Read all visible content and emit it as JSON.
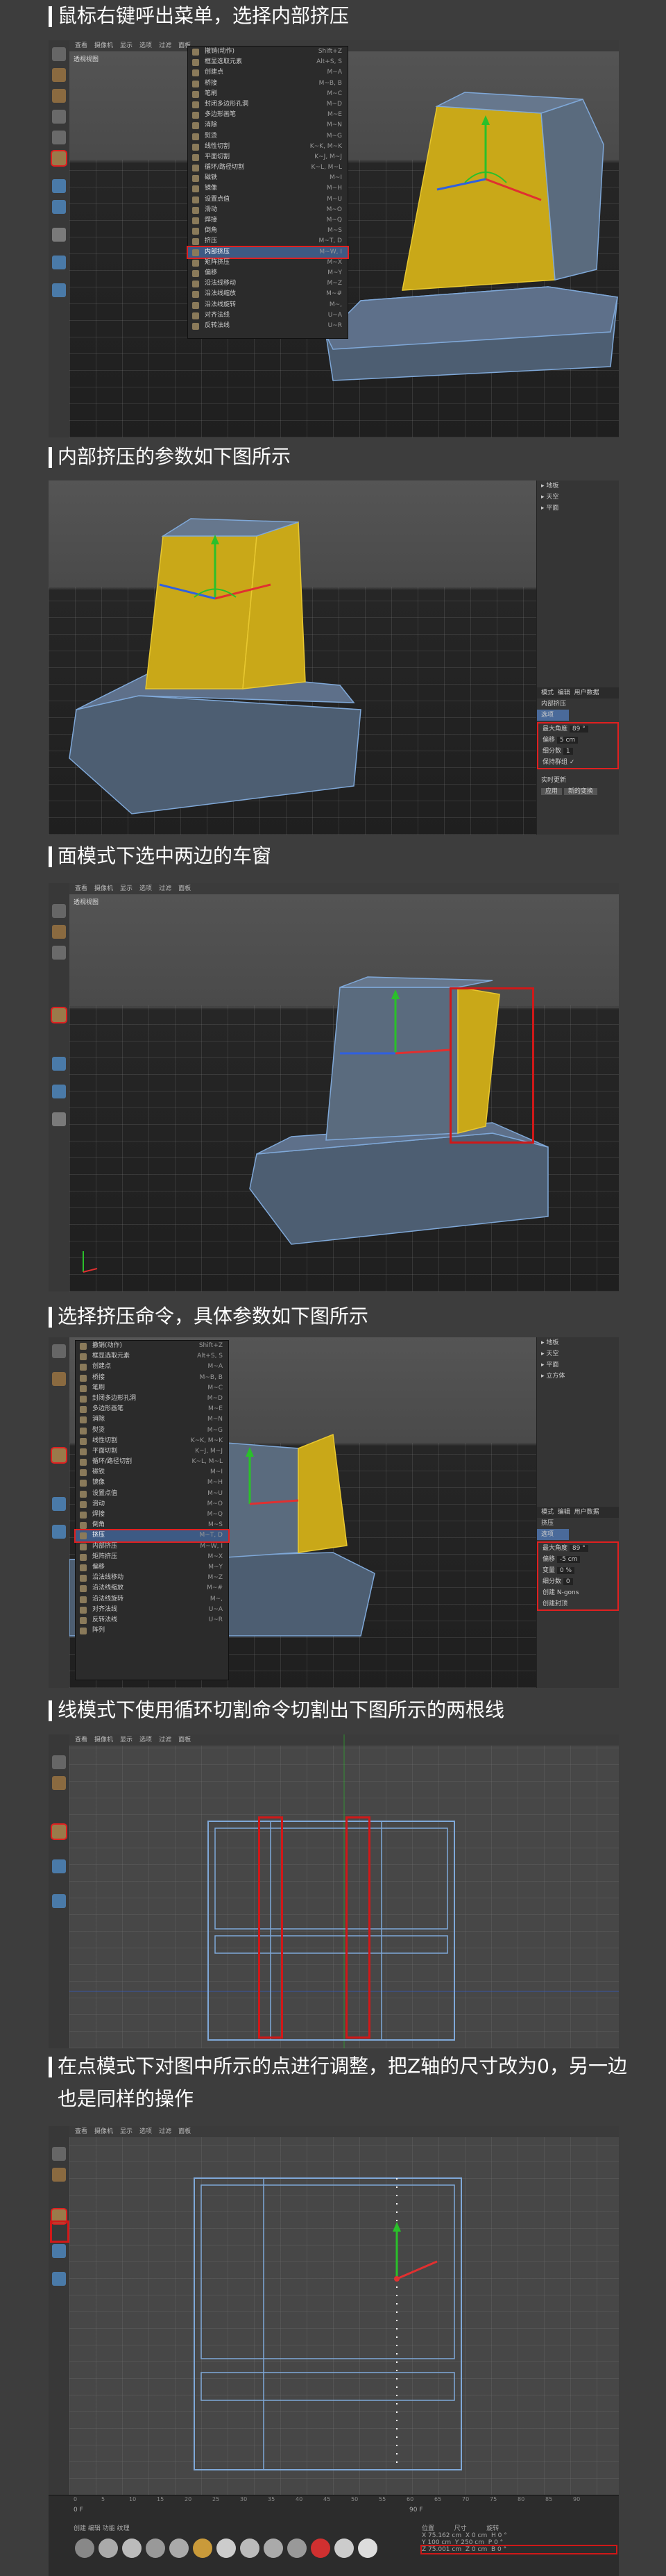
{
  "steps": [
    {
      "title": "鼠标右键呼出菜单，选择内部挤压"
    },
    {
      "title": "内部挤压的参数如下图所示"
    },
    {
      "title": "面模式下选中两边的车窗"
    },
    {
      "title": "选择挤压命令，具体参数如下图所示"
    },
    {
      "title": "线模式下使用循环切割命令切割出下图所示的两根线"
    },
    {
      "title": "在点模式下对图中所示的点进行调整，把Z轴的尺寸改为0，另一边",
      "title2": "也是同样的操作"
    }
  ],
  "viewport": {
    "menu": [
      "查看",
      "摄像机",
      "显示",
      "选项",
      "过滤",
      "面板"
    ],
    "label": "透视视图"
  },
  "context_menu_1": {
    "items": [
      {
        "label": "撤销(动作)",
        "shortcut": "Shift+Z"
      },
      {
        "label": "框显选取元素",
        "shortcut": "Alt+S, S"
      },
      {
        "label": "创建点",
        "shortcut": "M~A"
      },
      {
        "label": "桥接",
        "shortcut": "M~B, B"
      },
      {
        "label": "笔刷",
        "shortcut": "M~C"
      },
      {
        "label": "封闭多边形孔洞",
        "shortcut": "M~D"
      },
      {
        "label": "多边形画笔",
        "shortcut": "M~E"
      },
      {
        "label": "消除",
        "shortcut": "M~N"
      },
      {
        "label": "熨烫",
        "shortcut": "M~G"
      },
      {
        "label": "线性切割",
        "shortcut": "K~K, M~K"
      },
      {
        "label": "平面切割",
        "shortcut": "K~J, M~J"
      },
      {
        "label": "循环/路径切割",
        "shortcut": "K~L, M~L"
      },
      {
        "label": "磁铁",
        "shortcut": "M~I"
      },
      {
        "label": "镜像",
        "shortcut": "M~H"
      },
      {
        "label": "设置点值",
        "shortcut": "M~U"
      },
      {
        "label": "滑动",
        "shortcut": "M~O"
      },
      {
        "label": "焊接",
        "shortcut": "M~Q"
      },
      {
        "label": "倒角",
        "shortcut": "M~S"
      },
      {
        "label": "挤压",
        "shortcut": "M~T, D"
      },
      {
        "label": "内部挤压",
        "shortcut": "M~W, I"
      },
      {
        "label": "矩阵挤压",
        "shortcut": "M~X"
      },
      {
        "label": "偏移",
        "shortcut": "M~Y"
      },
      {
        "label": "沿法线移动",
        "shortcut": "M~Z"
      },
      {
        "label": "沿法线缩放",
        "shortcut": "M~#"
      },
      {
        "label": "沿法线旋转",
        "shortcut": "M~,"
      },
      {
        "label": "对齐法线",
        "shortcut": "U~A"
      },
      {
        "label": "反转法线",
        "shortcut": "U~R"
      }
    ]
  },
  "attributes_2": {
    "objects": [
      "地板",
      "天空",
      "平面",
      "立方体"
    ],
    "tabs": [
      "模式",
      "编辑",
      "用户数据"
    ],
    "tool_name": "内部挤压",
    "tab_options": "选项",
    "fields": [
      {
        "label": "最大角度",
        "value": "89 °"
      },
      {
        "label": "偏移",
        "value": "5 cm"
      },
      {
        "label": "细分数",
        "value": "1"
      },
      {
        "label": "保持群组",
        "value": "✓"
      }
    ],
    "buttons": [
      "应用",
      "新的变换"
    ],
    "realtime": "实时更新"
  },
  "context_menu_4": {
    "items": [
      {
        "label": "撤销(动作)",
        "shortcut": "Shift+Z"
      },
      {
        "label": "框显选取元素",
        "shortcut": "Alt+S, S"
      },
      {
        "label": "创建点",
        "shortcut": "M~A"
      },
      {
        "label": "桥接",
        "shortcut": "M~B, B"
      },
      {
        "label": "笔刷",
        "shortcut": "M~C"
      },
      {
        "label": "封闭多边形孔洞",
        "shortcut": "M~D"
      },
      {
        "label": "多边形画笔",
        "shortcut": "M~E"
      },
      {
        "label": "消除",
        "shortcut": "M~N"
      },
      {
        "label": "熨烫",
        "shortcut": "M~G"
      },
      {
        "label": "线性切割",
        "shortcut": "K~K, M~K"
      },
      {
        "label": "平面切割",
        "shortcut": "K~J, M~J"
      },
      {
        "label": "循环/路径切割",
        "shortcut": "K~L, M~L"
      },
      {
        "label": "磁铁",
        "shortcut": "M~I"
      },
      {
        "label": "镜像",
        "shortcut": "M~H"
      },
      {
        "label": "设置点值",
        "shortcut": "M~U"
      },
      {
        "label": "滑动",
        "shortcut": "M~O"
      },
      {
        "label": "焊接",
        "shortcut": "M~Q"
      },
      {
        "label": "倒角",
        "shortcut": "M~S"
      },
      {
        "label": "挤压",
        "shortcut": "M~T, D"
      },
      {
        "label": "内部挤压",
        "shortcut": "M~W, I"
      },
      {
        "label": "矩阵挤压",
        "shortcut": "M~X"
      },
      {
        "label": "偏移",
        "shortcut": "M~Y"
      },
      {
        "label": "沿法线移动",
        "shortcut": "M~Z"
      },
      {
        "label": "沿法线缩放",
        "shortcut": "M~#"
      },
      {
        "label": "沿法线旋转",
        "shortcut": "M~,"
      },
      {
        "label": "对齐法线",
        "shortcut": "U~A"
      },
      {
        "label": "反转法线",
        "shortcut": "U~R"
      },
      {
        "label": "阵列",
        "shortcut": ""
      }
    ]
  },
  "attributes_4": {
    "tool_name": "挤压",
    "fields": [
      {
        "label": "最大角度",
        "value": "89 °"
      },
      {
        "label": "偏移",
        "value": "-5 cm"
      },
      {
        "label": "变量",
        "value": "0 %"
      },
      {
        "label": "细分数",
        "value": "0"
      },
      {
        "label": "创建 N-gons",
        "value": ""
      },
      {
        "label": "创建封顶",
        "value": ""
      }
    ]
  },
  "timeline": {
    "frame_start": "0 F",
    "frame_end": "90 F",
    "ticks": [
      "0",
      "5",
      "10",
      "15",
      "20",
      "25",
      "30",
      "35",
      "40",
      "45",
      "50",
      "55",
      "60",
      "65",
      "70",
      "75",
      "80",
      "85",
      "90"
    ],
    "coords": {
      "header": [
        "位置",
        "尺寸",
        "旋转"
      ],
      "x": [
        "X",
        "75.162 cm",
        "X",
        "0 cm",
        "H",
        "0 °"
      ],
      "y": [
        "Y",
        "100 cm",
        "Y",
        "250 cm",
        "P",
        "0 °"
      ],
      "z": [
        "Z",
        "75.001 cm",
        "Z",
        "0 cm",
        "B",
        "0 °"
      ]
    },
    "menu": [
      "创建",
      "编辑",
      "功能",
      "纹理"
    ]
  },
  "colors": {
    "selected_face": "#c9a818",
    "mesh": "#5a6b7e",
    "edge": "#7fa8d8",
    "highlight_red": "#d01818",
    "y_axis": "#2ac02a",
    "x_axis": "#e03030",
    "z_axis": "#3060e0"
  }
}
